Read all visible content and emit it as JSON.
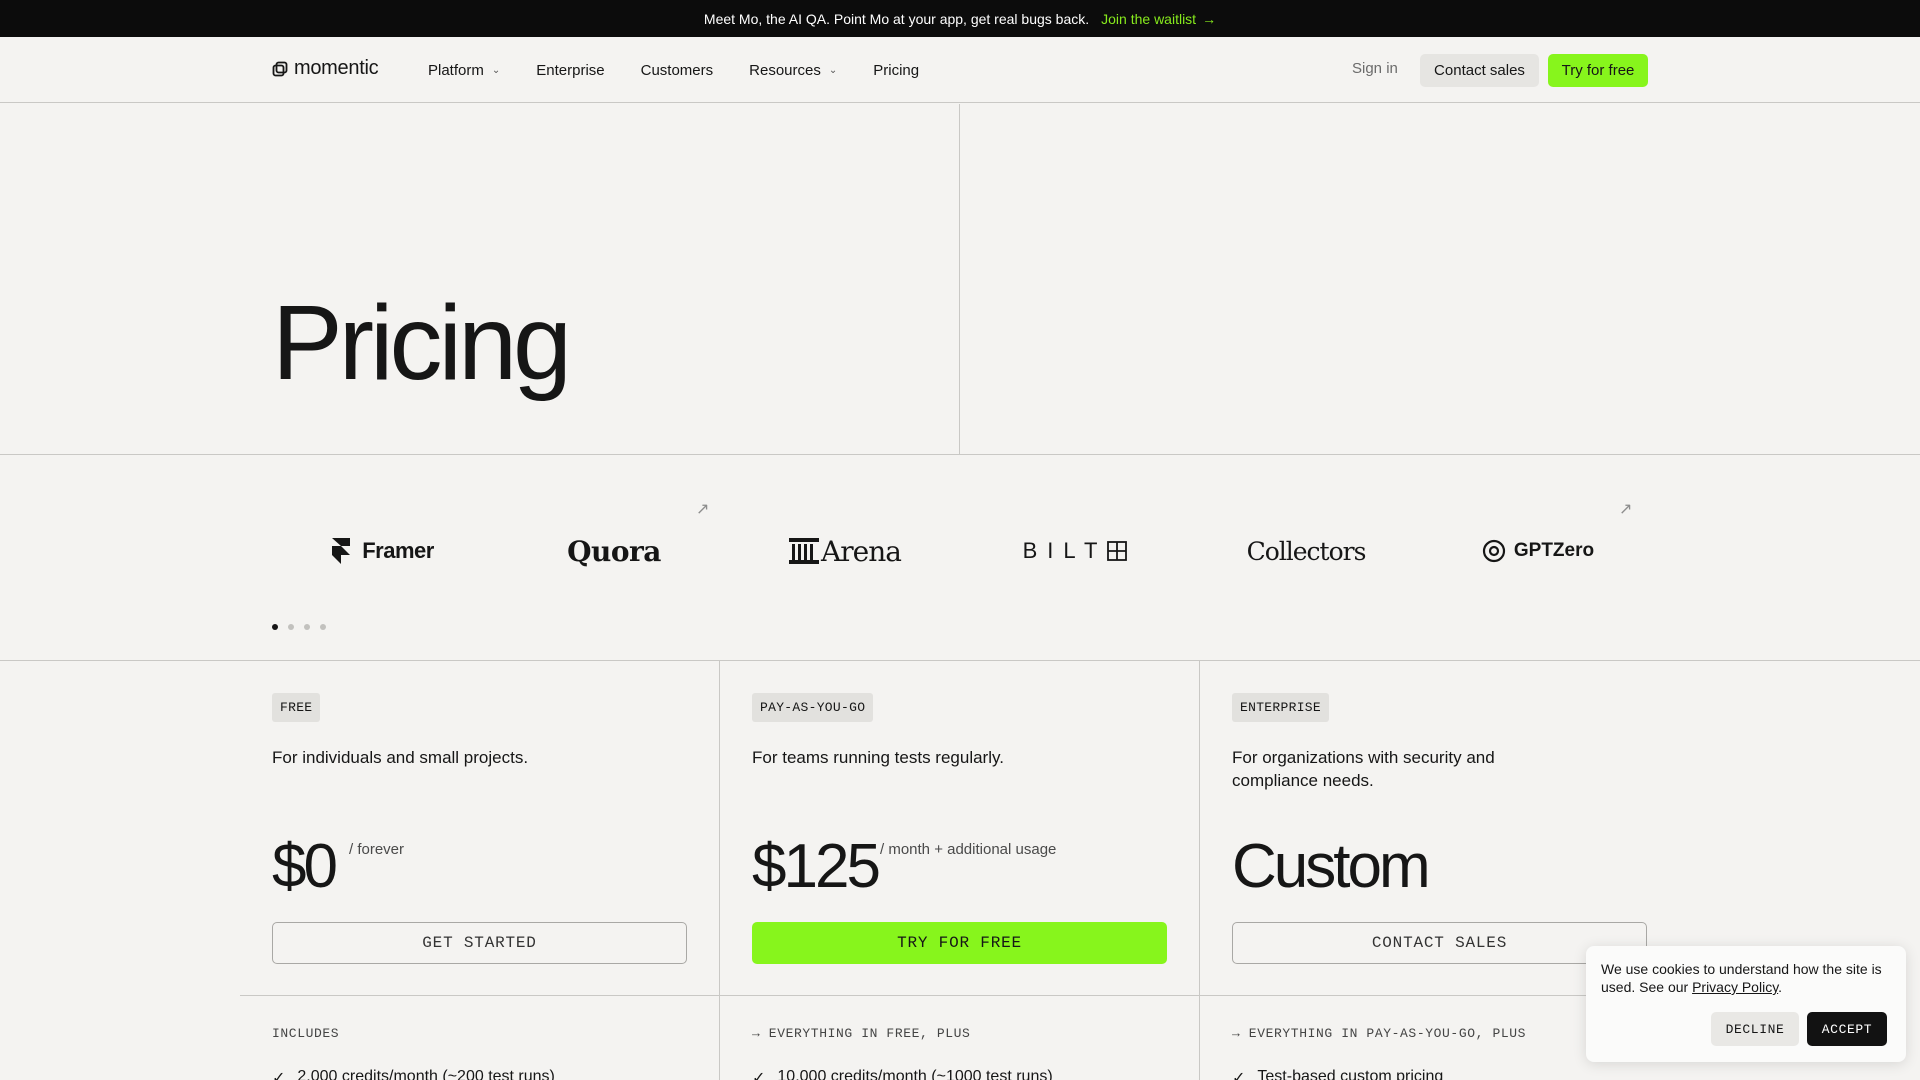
{
  "announcement": {
    "text": "Meet Mo, the AI QA. Point Mo at your app, get real bugs back.",
    "cta": "Join the waitlist",
    "cta_color": "#87ea1d"
  },
  "nav": {
    "logo": "momentic",
    "links": [
      "Platform",
      "Enterprise",
      "Customers",
      "Resources",
      "Pricing"
    ],
    "sign_in": "Sign in",
    "contact_sales": "Contact sales",
    "try_free": "Try for free",
    "accent": "#87f51c"
  },
  "hero": {
    "title": "Pricing"
  },
  "logos": {
    "names": [
      "Framer",
      "Quora",
      "Arena",
      "BILT",
      "Collectors",
      "GPTZero"
    ],
    "active_page": 1,
    "page_count": 4
  },
  "tiers": [
    {
      "badge": "FREE",
      "description": "For individuals and small projects.",
      "price": "$0",
      "price_note": "/ forever",
      "button": "GET STARTED",
      "includes": "INCLUDES",
      "feature": "2,000 credits/month (~200 test runs)"
    },
    {
      "badge": "PAY-AS-YOU-GO",
      "description": "For teams running tests regularly.",
      "price": "$125",
      "price_note": "/ month + additional usage",
      "button": "TRY FOR FREE",
      "includes": "→ EVERYTHING IN FREE, PLUS",
      "feature": "10,000 credits/month (~1000 test runs)"
    },
    {
      "badge": "ENTERPRISE",
      "description": "For organizations with security and compliance needs.",
      "price": "Custom",
      "price_note": "",
      "button": "CONTACT SALES",
      "includes": "→ EVERYTHING IN PAY-AS-YOU-GO, PLUS",
      "feature": "Test-based custom pricing"
    }
  ],
  "cookie": {
    "text": "We use cookies to understand how the site is used. See our",
    "link": "Privacy Policy",
    "decline": "DECLINE",
    "accept": "ACCEPT"
  }
}
